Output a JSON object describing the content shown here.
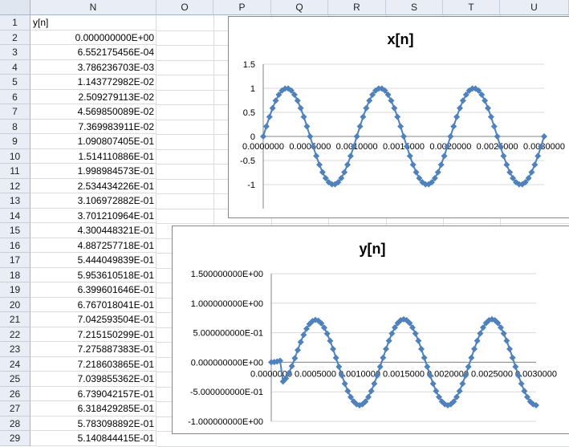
{
  "columns": [
    "N",
    "O",
    "P",
    "Q",
    "R",
    "S",
    "T",
    "U"
  ],
  "rows": [
    {
      "num": "1",
      "value": "y[n]",
      "kind": "txt"
    },
    {
      "num": "2",
      "value": "0.000000000E+00",
      "kind": "num"
    },
    {
      "num": "3",
      "value": "6.552175456E-04",
      "kind": "num"
    },
    {
      "num": "4",
      "value": "3.786236703E-03",
      "kind": "num"
    },
    {
      "num": "5",
      "value": "1.143772982E-02",
      "kind": "num"
    },
    {
      "num": "6",
      "value": "2.509279113E-02",
      "kind": "num"
    },
    {
      "num": "7",
      "value": "4.569850089E-02",
      "kind": "num"
    },
    {
      "num": "8",
      "value": "7.369983911E-02",
      "kind": "num"
    },
    {
      "num": "9",
      "value": "1.090807405E-01",
      "kind": "num"
    },
    {
      "num": "10",
      "value": "1.514110886E-01",
      "kind": "num"
    },
    {
      "num": "11",
      "value": "1.998984573E-01",
      "kind": "num"
    },
    {
      "num": "12",
      "value": "2.534434226E-01",
      "kind": "num"
    },
    {
      "num": "13",
      "value": "3.106972882E-01",
      "kind": "num"
    },
    {
      "num": "14",
      "value": "3.701210964E-01",
      "kind": "num"
    },
    {
      "num": "15",
      "value": "4.300448321E-01",
      "kind": "num"
    },
    {
      "num": "16",
      "value": "4.887257718E-01",
      "kind": "num"
    },
    {
      "num": "17",
      "value": "5.444049839E-01",
      "kind": "num"
    },
    {
      "num": "18",
      "value": "5.953610518E-01",
      "kind": "num"
    },
    {
      "num": "19",
      "value": "6.399601646E-01",
      "kind": "num"
    },
    {
      "num": "20",
      "value": "6.767018041E-01",
      "kind": "num"
    },
    {
      "num": "21",
      "value": "7.042593504E-01",
      "kind": "num"
    },
    {
      "num": "22",
      "value": "7.215150299E-01",
      "kind": "num"
    },
    {
      "num": "23",
      "value": "7.275887383E-01",
      "kind": "num"
    },
    {
      "num": "24",
      "value": "7.218603865E-01",
      "kind": "num"
    },
    {
      "num": "25",
      "value": "7.039855362E-01",
      "kind": "num"
    },
    {
      "num": "26",
      "value": "6.739042157E-01",
      "kind": "num"
    },
    {
      "num": "27",
      "value": "6.318429285E-01",
      "kind": "num"
    },
    {
      "num": "28",
      "value": "5.783098892E-01",
      "kind": "num"
    },
    {
      "num": "29",
      "value": "5.140844415E-01",
      "kind": "num"
    }
  ],
  "chart_data": [
    {
      "type": "scatter",
      "title": "x[n]",
      "xlim": [
        0,
        0.003
      ],
      "ylim": [
        -1.5,
        1.5
      ],
      "yticks": [
        "1.5",
        "1",
        "0.5",
        "0",
        "-0.5",
        "-1"
      ],
      "xtick_labels": [
        "0.0000000",
        "0.0005000",
        "0.0010000",
        "0.0015000",
        "0.0020000",
        "0.0025000",
        "0.0030000"
      ],
      "series": [
        {
          "color": "#4f81bd",
          "frequency_hz": 1000,
          "amplitude": 1,
          "n_points": 91
        }
      ]
    },
    {
      "type": "scatter",
      "title": "y[n]",
      "xlim": [
        0,
        0.003
      ],
      "ylim": [
        -1.0,
        1.5
      ],
      "yticks": [
        "1.500000000E+00",
        "1.000000000E+00",
        "5.000000000E-01",
        "0.000000000E+00",
        "-5.000000000E-01",
        "-1.000000000E+00"
      ],
      "xtick_labels": [
        "0.0000000",
        "0.0005000",
        "0.0010000",
        "0.0015000",
        "0.0020000",
        "0.0025000",
        "0.0030000"
      ],
      "series": [
        {
          "color": "#4f81bd",
          "frequency_hz": 1000,
          "amplitude": 0.7276,
          "n_points": 91
        }
      ]
    }
  ]
}
